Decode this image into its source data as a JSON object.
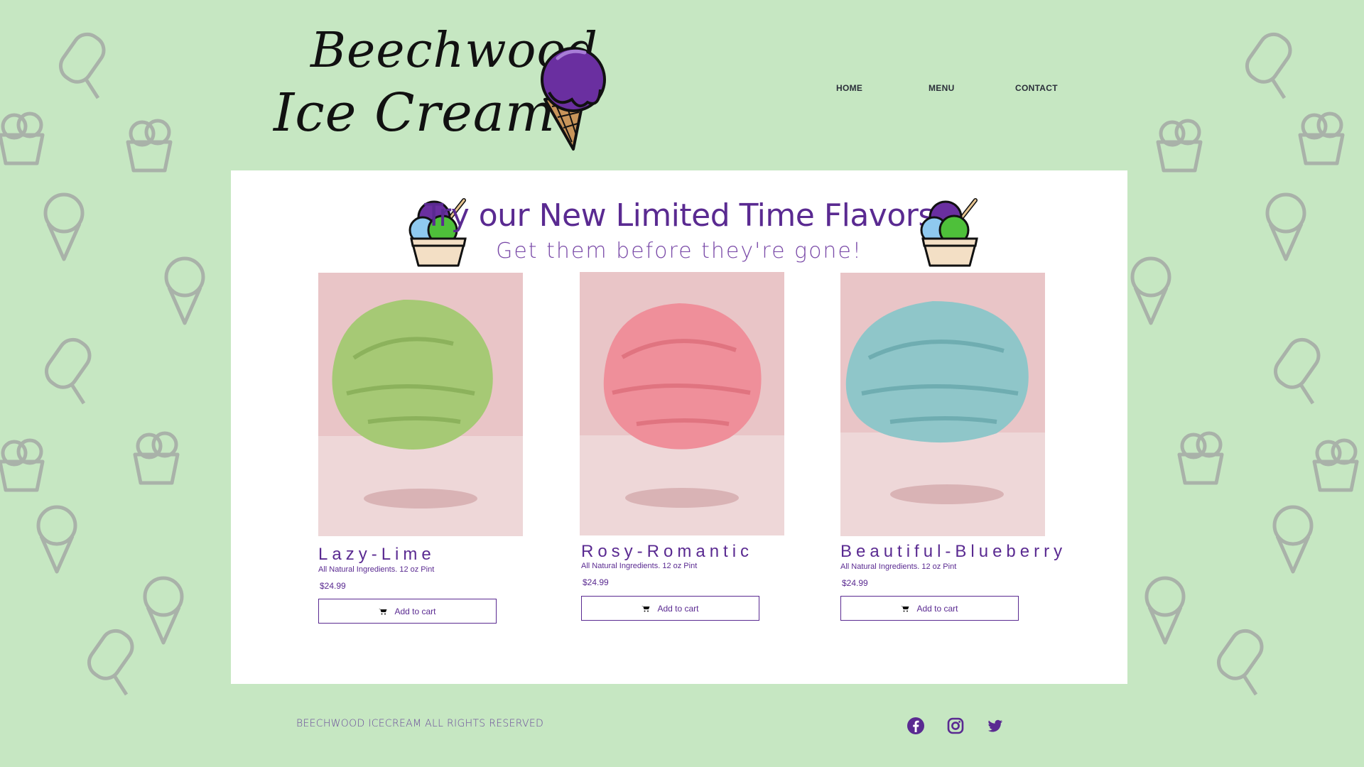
{
  "brand": {
    "logo_line1": "Beechwood",
    "logo_line2": "Ice Cream"
  },
  "nav": {
    "items": [
      {
        "label": "HOME"
      },
      {
        "label": "MENU"
      },
      {
        "label": "CONTACT"
      }
    ]
  },
  "banner": {
    "title": "Try our New Limited Time Flavors",
    "subtitle": "Get them before they're gone!"
  },
  "products": [
    {
      "name": "Lazy-Lime",
      "description": "All Natural Ingredients. 12 oz Pint",
      "price": "$24.99",
      "button": "Add to cart",
      "color": "#a6c975"
    },
    {
      "name": "Rosy-Romantic",
      "description": "All Natural Ingredients. 12 oz Pint",
      "price": "$24.99",
      "button": "Add to cart",
      "color": "#ef8f9a"
    },
    {
      "name": "Beautiful-Blueberry",
      "description": "All Natural Ingredients. 12 oz Pint",
      "price": "$24.99",
      "button": "Add to cart",
      "color": "#8fc6c9"
    }
  ],
  "footer": {
    "copyright": "BEECHWOOD ICECREAM ALL RIGHTS RESERVED",
    "social": [
      {
        "icon": "facebook-icon"
      },
      {
        "icon": "instagram-icon"
      },
      {
        "icon": "twitter-icon"
      }
    ]
  },
  "colors": {
    "background": "#c6e7c2",
    "accent": "#5a2a91",
    "card_bg": "#e8cfd0"
  }
}
